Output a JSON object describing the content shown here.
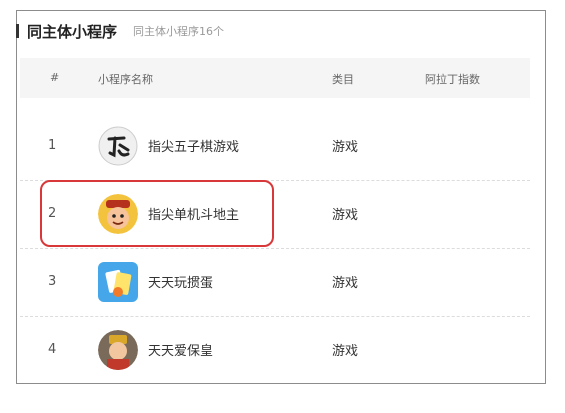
{
  "header": {
    "title": "同主体小程序",
    "subtitle": "同主体小程序16个"
  },
  "table": {
    "columns": {
      "index": "#",
      "name": "小程序名称",
      "category": "类目",
      "aladdin": "阿拉丁指数"
    },
    "rows": [
      {
        "index": "1",
        "name": "指尖五子棋游戏",
        "category": "游戏",
        "avatar": "gomoku-calligraphy-icon"
      },
      {
        "index": "2",
        "name": "指尖单机斗地主",
        "category": "游戏",
        "avatar": "cartoon-character-icon"
      },
      {
        "index": "3",
        "name": "天天玩掼蛋",
        "category": "游戏",
        "avatar": "cards-icon"
      },
      {
        "index": "4",
        "name": "天天爱保皇",
        "category": "游戏",
        "avatar": "emperor-figure-icon"
      }
    ]
  },
  "colors": {
    "highlight": "#d9383a"
  }
}
